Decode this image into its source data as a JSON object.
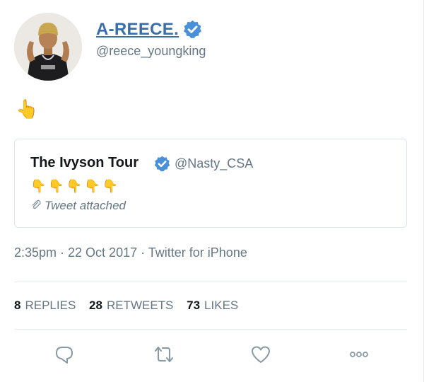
{
  "author": {
    "display_name": "A-REECE.",
    "handle": "@reece_youngking",
    "verified": true
  },
  "tweet": {
    "text": "👆"
  },
  "quoted_tweet": {
    "display_name": "The Ivyson Tour",
    "handle": "@Nasty_CSA",
    "verified": true,
    "text": "👇👇👇👇👇",
    "attachment_label": "Tweet attached"
  },
  "meta": {
    "timestamp": "2:35pm · 22 Oct 2017 · Twitter for iPhone"
  },
  "stats": {
    "replies_count": "8",
    "replies_label": "REPLIES",
    "retweets_count": "28",
    "retweets_label": "RETWEETS",
    "likes_count": "73",
    "likes_label": "LIKES"
  },
  "actions": [
    "reply-icon",
    "retweet-icon",
    "like-icon",
    "more-icon"
  ],
  "colors": {
    "name_link": "#3a6ea8",
    "verified_badge": "#4a90d9",
    "secondary_text": "#657786",
    "divider": "#e6ecf0"
  }
}
